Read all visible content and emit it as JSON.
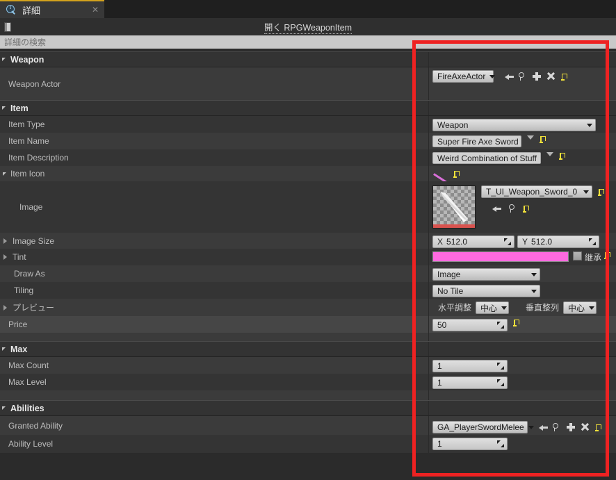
{
  "tab": {
    "title": "詳細",
    "icon": "details-info-icon",
    "close": "✕"
  },
  "toolbar": {
    "icon": "document-icon",
    "open_link": "開く RPGWeaponItem"
  },
  "search": {
    "placeholder": "詳細の検索"
  },
  "icons": {
    "back": "back-arrow-icon",
    "browse": "browse-magnifier-icon",
    "add": "plus-icon",
    "clear": "clear-x-icon",
    "reset": "reset-to-default-icon",
    "drag": "drag-value-icon",
    "caret": "chevron-down-icon"
  },
  "sections": [
    {
      "name": "Weapon",
      "rows": [
        {
          "label": "Weapon Actor",
          "control": "asset-picker",
          "value": "FireAxeActor"
        }
      ]
    },
    {
      "name": "Item",
      "rows": [
        {
          "label": "Item Type",
          "control": "enum-dropdown",
          "value": "Weapon"
        },
        {
          "label": "Item Name",
          "control": "text-with-dropdown",
          "value": "Super Fire Axe Sword"
        },
        {
          "label": "Item Description",
          "control": "text-with-dropdown",
          "value": "Weird Combination of Stuff"
        },
        {
          "label": "Item Icon",
          "control": "group-header"
        },
        {
          "label": "Image",
          "control": "texture-picker",
          "value": "T_UI_Weapon_Sword_0"
        },
        {
          "label": "Image Size",
          "control": "vector2",
          "x_axis": "X",
          "x_value": "512.0",
          "y_axis": "Y",
          "y_value": "512.0"
        },
        {
          "label": "Tint",
          "control": "color",
          "color": "#ff6ae0",
          "inherit_label": "継承"
        },
        {
          "label": "Draw As",
          "control": "enum-dropdown",
          "value": "Image"
        },
        {
          "label": "Tiling",
          "control": "enum-dropdown",
          "value": "No Tile"
        },
        {
          "label": "プレビュー",
          "control": "alignment",
          "h_label": "水平調整",
          "h_value": "中心",
          "v_label": "垂直整列",
          "v_value": "中心"
        },
        {
          "label": "Price",
          "control": "number",
          "value": "50"
        }
      ]
    },
    {
      "name": "Max",
      "rows": [
        {
          "label": "Max Count",
          "control": "number",
          "value": "1"
        },
        {
          "label": "Max Level",
          "control": "number",
          "value": "1"
        }
      ]
    },
    {
      "name": "Abilities",
      "rows": [
        {
          "label": "Granted Ability",
          "control": "asset-picker",
          "value": "GA_PlayerSwordMelee"
        },
        {
          "label": "Ability Level",
          "control": "number",
          "value": "1"
        }
      ]
    }
  ],
  "annotation": {
    "color": "#ee2222",
    "shape": "rectangle-highlight"
  }
}
